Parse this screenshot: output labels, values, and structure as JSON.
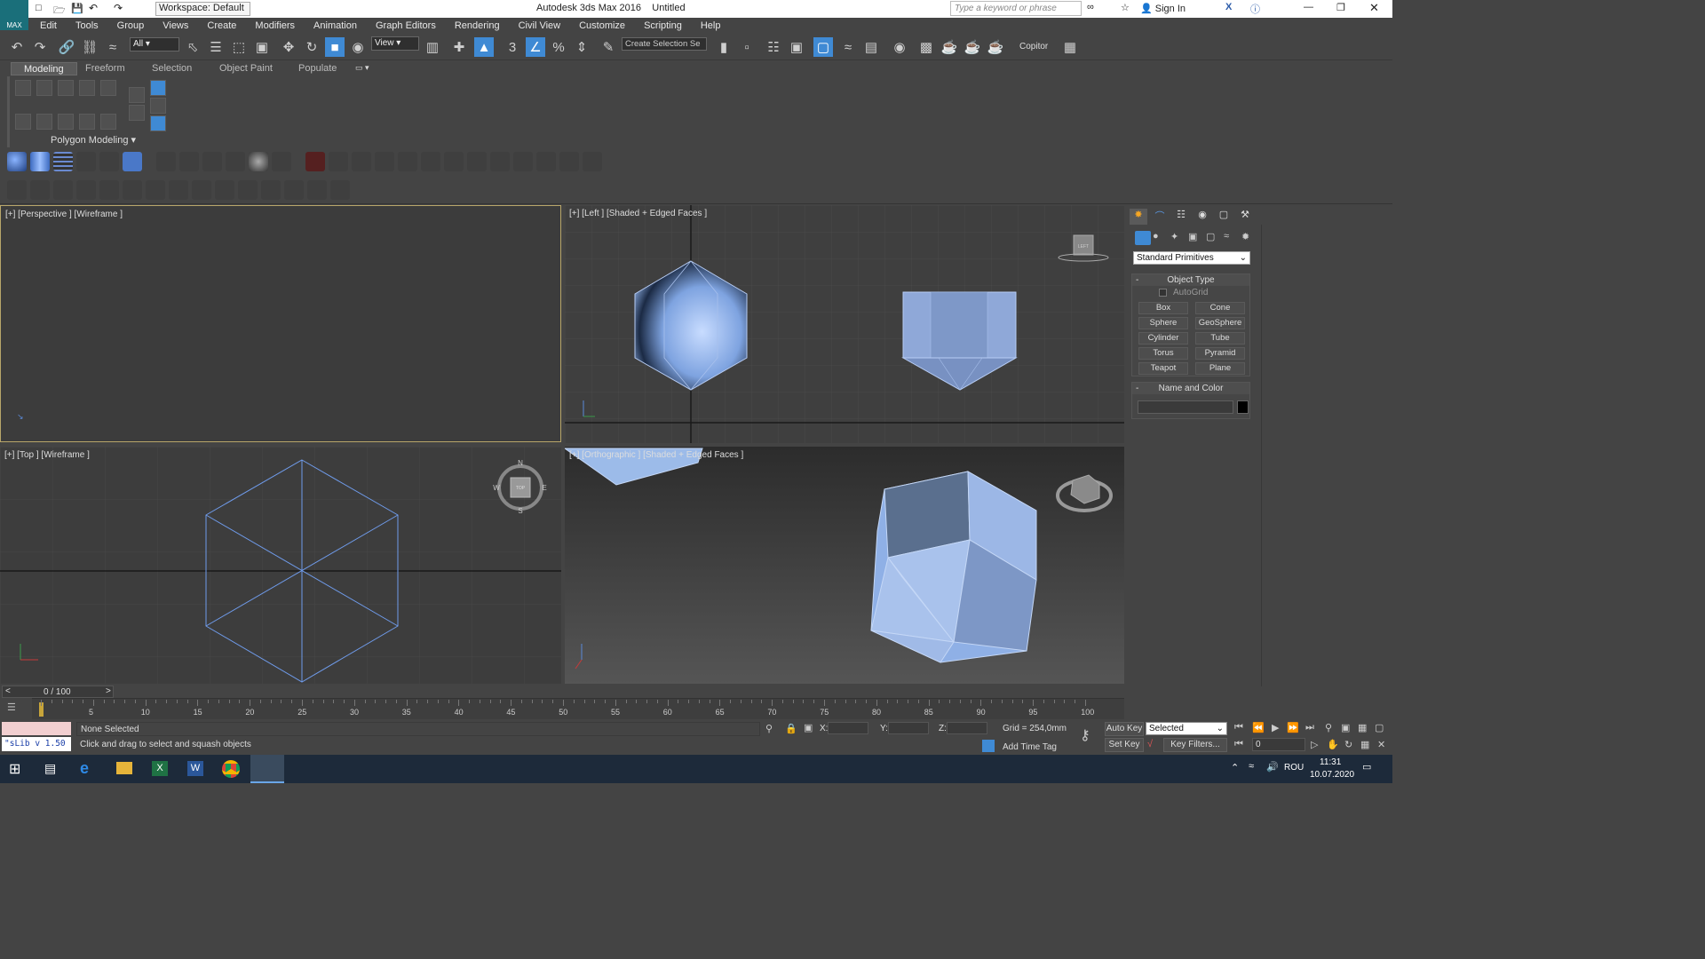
{
  "window": {
    "title": "Autodesk 3ds Max 2016",
    "doc": "Untitled",
    "workspace": "Workspace: Default",
    "search_placeholder": "Type a keyword or phrase",
    "sign_in": "Sign In",
    "logo": "MAX"
  },
  "menu": [
    "Edit",
    "Tools",
    "Group",
    "Views",
    "Create",
    "Modifiers",
    "Animation",
    "Graph Editors",
    "Rendering",
    "Civil View",
    "Customize",
    "Scripting",
    "Help"
  ],
  "toolbar": {
    "filter": "All",
    "coord": "View",
    "selection_set": "Create Selection Se",
    "copitor": "Copitor"
  },
  "ribbon": {
    "tabs": [
      "Modeling",
      "Freeform",
      "Selection",
      "Object Paint",
      "Populate"
    ],
    "active_tab": "Modeling",
    "group": "Polygon Modeling"
  },
  "viewports": {
    "perspective": "[+] [Perspective ] [Wireframe ]",
    "left": "[+] [Left ] [Shaded + Edged Faces ]",
    "top": "[+] [Top ] [Wireframe ]",
    "ortho": "[+] [Orthographic ] [Shaded + Edged Faces ]",
    "viewcube_left": "LEFT",
    "viewcube_top": "TOP",
    "compass": {
      "n": "N",
      "s": "S",
      "e": "E",
      "w": "W"
    }
  },
  "command_panel": {
    "dropdown": "Standard Primitives",
    "rollout_object_type": "Object Type",
    "autogrid": "AutoGrid",
    "buttons": [
      "Box",
      "Cone",
      "Sphere",
      "GeoSphere",
      "Cylinder",
      "Tube",
      "Torus",
      "Pyramid",
      "Teapot",
      "Plane"
    ],
    "rollout_name_color": "Name and Color",
    "colors": {
      "swatch": "#000000",
      "object": "#8fb0e6"
    }
  },
  "timeline": {
    "frame": "0 / 100",
    "ticks": [
      "5",
      "10",
      "15",
      "20",
      "25",
      "30",
      "35",
      "40",
      "45",
      "50",
      "55",
      "60",
      "65",
      "70",
      "75",
      "80",
      "85",
      "90",
      "95",
      "100"
    ]
  },
  "status": {
    "script": "\"sLib v 1.50",
    "selection": "None Selected",
    "prompt": "Click and drag to select and squash objects",
    "x": "X:",
    "y": "Y:",
    "z": "Z:",
    "grid": "Grid = 254,0mm",
    "add_time_tag": "Add Time Tag",
    "auto_key": "Auto Key",
    "set_key": "Set Key",
    "selected": "Selected",
    "key_filters": "Key Filters...",
    "frame_value": "0"
  },
  "taskbar": {
    "lang": "ROU",
    "time": "11:31",
    "date": "10.07.2020"
  }
}
